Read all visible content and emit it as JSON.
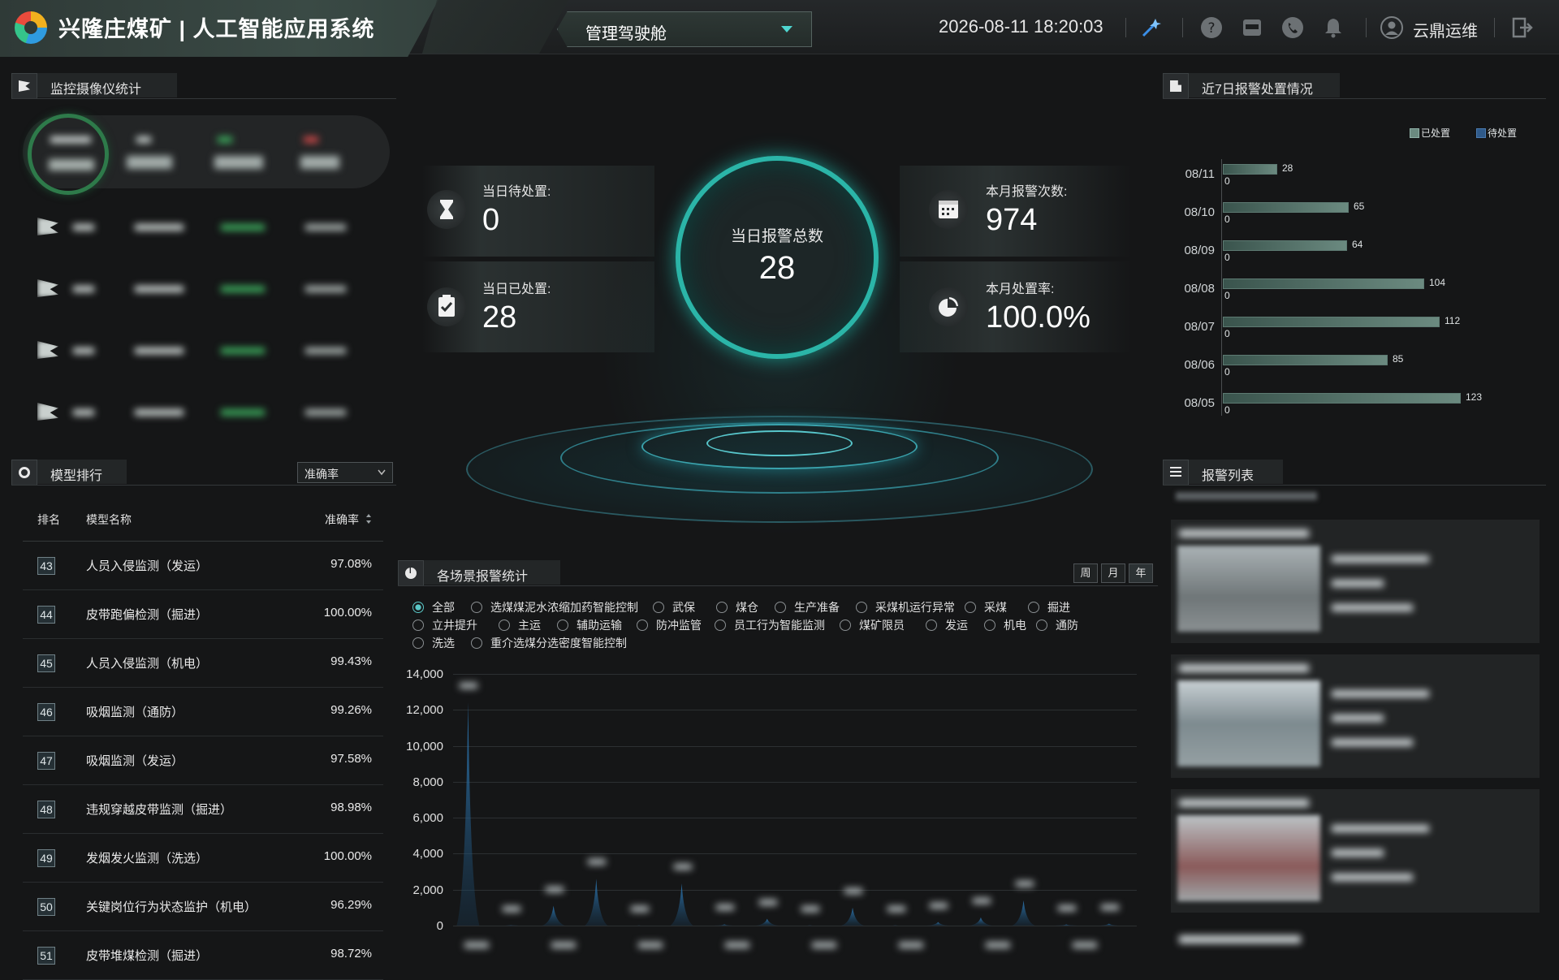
{
  "header": {
    "title": "兴隆庄煤矿 | 人工智能应用系统",
    "cockpit_label": "管理驾驶舱",
    "datetime": "2026-08-11 18:20:03",
    "user_name": "云鼎运维",
    "icons": [
      "magic-wand-icon",
      "help-icon",
      "app-icon",
      "phone-icon",
      "bell-icon",
      "user-icon",
      "logout-icon"
    ]
  },
  "camera_panel": {
    "title": "监控摄像仪统计"
  },
  "stats": {
    "pending_label": "当日待处置:",
    "pending_value": "0",
    "handled_label": "当日已处置:",
    "handled_value": "28",
    "total_label": "当日报警总数",
    "total_value": "28",
    "month_count_label": "本月报警次数:",
    "month_count_value": "974",
    "month_rate_label": "本月处置率:",
    "month_rate_value": "100.0%"
  },
  "weekly_panel": {
    "title": "近7日报警处置情况",
    "legend_handled": "已处置",
    "legend_pending": "待处置"
  },
  "chart_data": [
    {
      "type": "bar",
      "orientation": "horizontal",
      "categories": [
        "08/11",
        "08/10",
        "08/09",
        "08/08",
        "08/07",
        "08/06",
        "08/05"
      ],
      "series": [
        {
          "name": "已处置",
          "values": [
            28,
            65,
            64,
            104,
            112,
            85,
            123
          ]
        },
        {
          "name": "待处置",
          "values": [
            0,
            0,
            0,
            0,
            0,
            0,
            0
          ]
        }
      ],
      "legend": "top-right",
      "colors": [
        "#6b8a80",
        "#2f5a8a"
      ]
    },
    {
      "type": "area",
      "title": "各场景报警统计",
      "yticks": [
        "14,000",
        "12,000",
        "10,000",
        "8,000",
        "6,000",
        "4,000",
        "2,000",
        "0"
      ],
      "ylim": [
        0,
        14000
      ],
      "peaks": [
        12400,
        18,
        1100,
        2600,
        8,
        2340,
        70,
        380,
        6,
        1000,
        6,
        200,
        450,
        1400,
        60,
        110
      ],
      "grid": true
    }
  ],
  "model_panel": {
    "title": "模型排行",
    "sort_select": "准确率",
    "col_rank": "排名",
    "col_name": "模型名称",
    "col_acc": "准确率",
    "rows": [
      {
        "rank": "43",
        "name": "人员入侵监测（发运）",
        "acc": "97.08%"
      },
      {
        "rank": "44",
        "name": "皮带跑偏检测（掘进）",
        "acc": "100.00%"
      },
      {
        "rank": "45",
        "name": "人员入侵监测（机电）",
        "acc": "99.43%"
      },
      {
        "rank": "46",
        "name": "吸烟监测（通防）",
        "acc": "99.26%"
      },
      {
        "rank": "47",
        "name": "吸烟监测（发运）",
        "acc": "97.58%"
      },
      {
        "rank": "48",
        "name": "违规穿越皮带监测（掘进）",
        "acc": "98.98%"
      },
      {
        "rank": "49",
        "name": "发烟发火监测（洗选）",
        "acc": "100.00%"
      },
      {
        "rank": "50",
        "name": "关键岗位行为状态监护（机电）",
        "acc": "96.29%"
      },
      {
        "rank": "51",
        "name": "皮带堆煤检测（掘进）",
        "acc": "98.72%"
      }
    ]
  },
  "scene_panel": {
    "title": "各场景报警统计",
    "period_week": "周",
    "period_month": "月",
    "period_year": "年",
    "filters": [
      "全部",
      "选煤煤泥水浓缩加药智能控制",
      "武保",
      "煤仓",
      "生产准备",
      "采煤机运行异常",
      "采煤",
      "掘进",
      "立井提升",
      "主运",
      "辅助运输",
      "防冲监管",
      "员工行为智能监测",
      "煤矿限员",
      "发运",
      "机电",
      "通防",
      "洗选",
      "重介选煤分选密度智能控制"
    ]
  },
  "alarm_list": {
    "title": "报警列表"
  }
}
